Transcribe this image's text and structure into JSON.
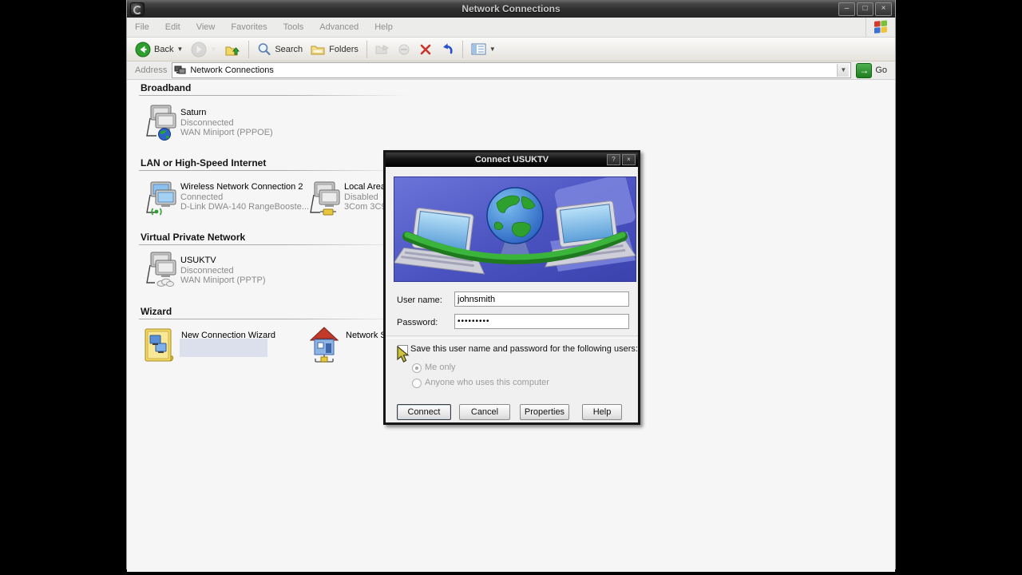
{
  "window": {
    "title": "Network Connections",
    "controls": {
      "minimize": "–",
      "maximize": "□",
      "close": "×"
    },
    "menu": {
      "items": [
        "File",
        "Edit",
        "View",
        "Favorites",
        "Tools",
        "Advanced",
        "Help"
      ]
    },
    "toolbar": {
      "back_label": "Back",
      "search_label": "Search",
      "folders_label": "Folders"
    },
    "address": {
      "label": "Address",
      "value": "Network Connections",
      "go_label": "Go"
    }
  },
  "sections": [
    {
      "title": "Broadband",
      "items": [
        {
          "name": "Saturn",
          "status": "Disconnected",
          "device": "WAN Miniport (PPPOE)",
          "icon": "globe-connection-icon"
        }
      ]
    },
    {
      "title": "LAN or High-Speed Internet",
      "items": [
        {
          "name": "Wireless Network Connection 2",
          "status": "Connected",
          "device": "D-Link DWA-140 RangeBooste...",
          "icon": "wireless-connection-icon"
        },
        {
          "name": "Local Area",
          "status": "Disabled",
          "device": "3Com 3C9",
          "icon": "lan-connection-icon"
        }
      ]
    },
    {
      "title": "Virtual Private Network",
      "items": [
        {
          "name": "USUKTV",
          "status": "Disconnected",
          "device": "WAN Miniport (PPTP)",
          "icon": "vpn-connection-icon"
        }
      ]
    },
    {
      "title": "Wizard",
      "items": [
        {
          "name": "New Connection Wizard",
          "icon": "new-connection-wizard-icon"
        },
        {
          "name": "Network S",
          "icon": "network-setup-wizard-icon"
        }
      ]
    }
  ],
  "dialog": {
    "title": "Connect USUKTV",
    "help_glyph": "?",
    "close_glyph": "×",
    "username_label": "User name:",
    "username_value": "johnsmith",
    "password_label": "Password:",
    "password_value": "•••••••••",
    "save_checkbox_label": "Save this user name and password for the following users:",
    "radio_me_only": "Me only",
    "radio_anyone": "Anyone who uses this computer",
    "buttons": {
      "connect": "Connect",
      "cancel": "Cancel",
      "properties": "Properties",
      "help": "Help"
    }
  },
  "colors": {
    "accent_green": "#2f9e2f",
    "banner_blue": "#4650bc",
    "titlebar_dark": "#2e2e2e",
    "selection": "#dbe0ec"
  }
}
